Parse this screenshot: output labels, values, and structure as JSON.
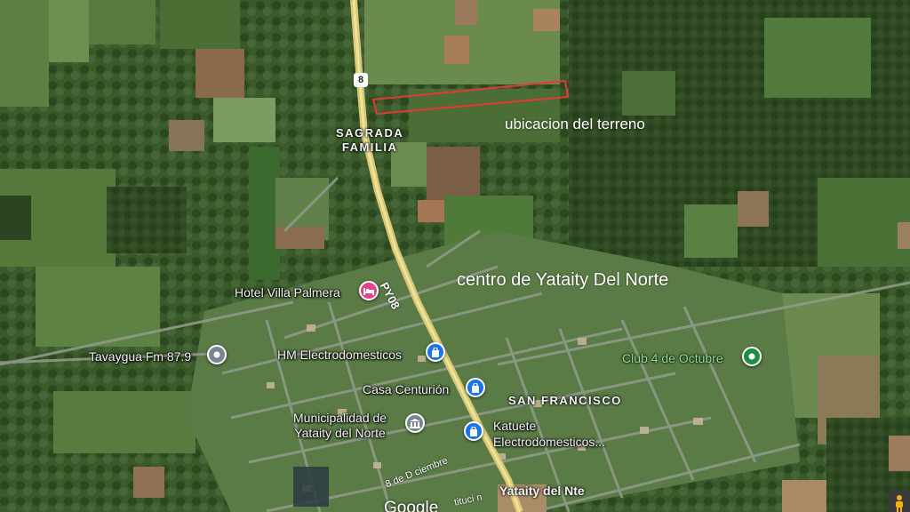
{
  "map": {
    "route_shield": "8",
    "road_label": "PY08",
    "area_labels": {
      "sagrada_familia": "SAGRADA\nFAMILIA",
      "san_francisco": "SAN FRANCISCO",
      "yataity_nte": "Yataity del Nte"
    },
    "annotations": {
      "plot_location": "ubicacion del terreno",
      "town_center": "centro de Yataity Del Norte"
    },
    "pois": [
      {
        "name": "Hotel Villa Palmera",
        "icon": "bed-icon",
        "color": "#e8418c"
      },
      {
        "name": "Tavaygua Fm 87.9",
        "icon": "dot-icon",
        "color": "#7b8591"
      },
      {
        "name": "HM Electrodomesticos",
        "icon": "shopping-bag-icon",
        "color": "#1a73e8"
      },
      {
        "name": "Casa Centurión",
        "icon": "shopping-bag-icon",
        "color": "#1a73e8"
      },
      {
        "name": "Municipalidad de\nYataity del Norte",
        "icon": "building-icon",
        "color": "#7b8591"
      },
      {
        "name": "Katuete\nElectrodomesticos...",
        "icon": "shopping-bag-icon",
        "color": "#1a73e8"
      },
      {
        "name": "Club 4 de Octubre",
        "icon": "park-icon",
        "color": "#1e8e3e"
      }
    ],
    "street_labels": {
      "eight_dec": "8 de D ciembre",
      "constitucion": "tituci n"
    },
    "marker_color": "#e53935",
    "logo": "Google"
  }
}
